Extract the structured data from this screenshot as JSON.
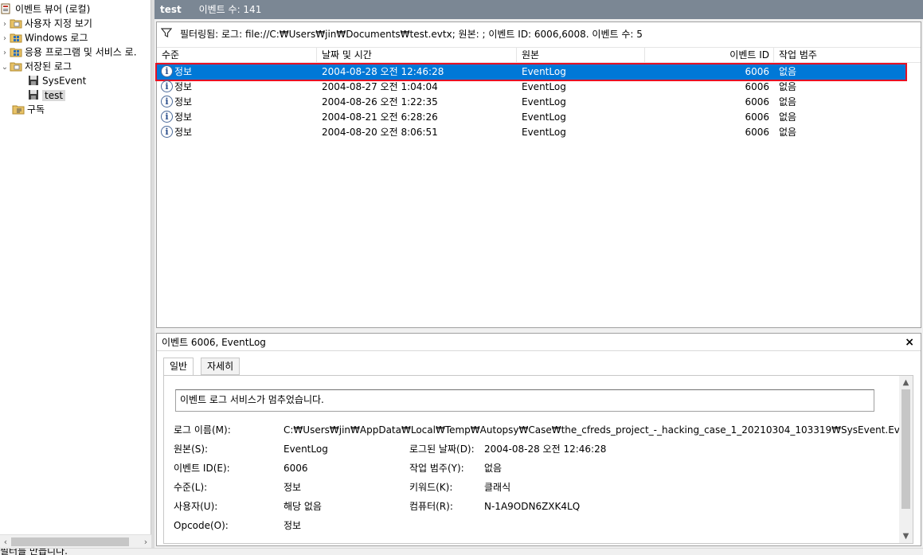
{
  "tree": {
    "items": [
      {
        "label": "이벤트 뷰어 (로컬)",
        "icon": "event-viewer-icon",
        "arrow": ""
      },
      {
        "label": "사용자 지정 보기",
        "icon": "folder-icon",
        "arrow": "›"
      },
      {
        "label": "Windows 로그",
        "icon": "windows-log-icon",
        "arrow": "›"
      },
      {
        "label": "응용 프로그램 및 서비스 로.",
        "icon": "windows-log-icon",
        "arrow": "›"
      },
      {
        "label": "저장된 로그",
        "icon": "folder-icon",
        "arrow": "⌄"
      },
      {
        "label": "SysEvent",
        "icon": "saved-log-icon",
        "arrow": ""
      },
      {
        "label": "test",
        "icon": "saved-log-icon",
        "arrow": ""
      },
      {
        "label": "구독",
        "icon": "subscription-icon",
        "arrow": ""
      }
    ]
  },
  "header": {
    "title": "test",
    "count": "이벤트 수: 141"
  },
  "filter": {
    "text": "필터링됨: 로그: file://C:₩Users₩jin₩Documents₩test.evtx; 원본: ; 이벤트 ID: 6006,6008. 이벤트 수: 5"
  },
  "columns": {
    "level": "수준",
    "date": "날짜 및 시간",
    "source": "원본",
    "event_id": "이벤트 ID",
    "task": "작업 범주"
  },
  "events": [
    {
      "level": "정보",
      "date": "2004-08-28 오전 12:46:28",
      "source": "EventLog",
      "id": "6006",
      "task": "없음"
    },
    {
      "level": "정보",
      "date": "2004-08-27 오전 1:04:04",
      "source": "EventLog",
      "id": "6006",
      "task": "없음"
    },
    {
      "level": "정보",
      "date": "2004-08-26 오전 1:22:35",
      "source": "EventLog",
      "id": "6006",
      "task": "없음"
    },
    {
      "level": "정보",
      "date": "2004-08-21 오전 6:28:26",
      "source": "EventLog",
      "id": "6006",
      "task": "없음"
    },
    {
      "level": "정보",
      "date": "2004-08-20 오전 8:06:51",
      "source": "EventLog",
      "id": "6006",
      "task": "없음"
    }
  ],
  "detail": {
    "title": "이벤트 6006, EventLog",
    "close": "×",
    "tabs": [
      "일반",
      "자세히"
    ],
    "message": "이벤트 로그 서비스가 멈추었습니다.",
    "log_name_label": "로그 이름(M):",
    "log_name_value": "C:₩Users₩jin₩AppData₩Local₩Temp₩Autopsy₩Case₩the_cfreds_project_-_hacking_case_1_20210304_103319₩SysEvent.Evt",
    "source_label": "원본(S):",
    "source_value": "EventLog",
    "logged_label": "로그된 날짜(D):",
    "logged_value": "2004-08-28 오전 12:46:28",
    "event_id_label": "이벤트 ID(E):",
    "event_id_value": "6006",
    "task_label": "작업 범주(Y):",
    "task_value": "없음",
    "level_label": "수준(L):",
    "level_value": "정보",
    "keyword_label": "키워드(K):",
    "keyword_value": "클래식",
    "user_label": "사용자(U):",
    "user_value": "해당 없음",
    "computer_label": "컴퓨터(R):",
    "computer_value": "N-1A9ODN6ZXK4LQ",
    "opcode_label": "Opcode(O):",
    "opcode_value": "정보"
  },
  "statusbar": {
    "text": "필터를 만듭니다."
  },
  "colors": {
    "header_bg": "#7b8794",
    "selection": "#0078d7",
    "highlight_box": "#e81123"
  }
}
